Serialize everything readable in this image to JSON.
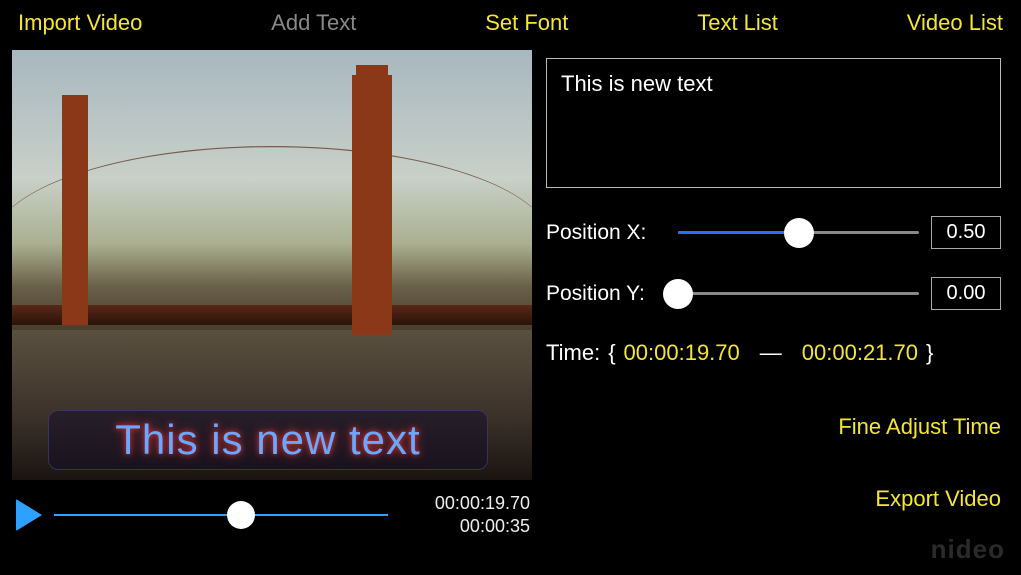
{
  "menu": {
    "import_video": "Import Video",
    "add_text": "Add Text",
    "set_font": "Set Font",
    "text_list": "Text List",
    "video_list": "Video List"
  },
  "overlay": {
    "text": "This is new text"
  },
  "playback": {
    "current_time": "00:00:19.70",
    "total_time": "00:00:35",
    "progress_fraction": 0.56
  },
  "editor": {
    "text_value": "This is new text",
    "position_x": {
      "label": "Position X:",
      "value": "0.50",
      "fraction": 0.5
    },
    "position_y": {
      "label": "Position Y:",
      "value": "0.00",
      "fraction": 0.0
    },
    "time_label": "Time:",
    "time_start": "00:00:19.70",
    "time_end": "00:00:21.70"
  },
  "actions": {
    "fine_adjust": "Fine Adjust Time",
    "export": "Export Video"
  },
  "watermark": "nideo"
}
